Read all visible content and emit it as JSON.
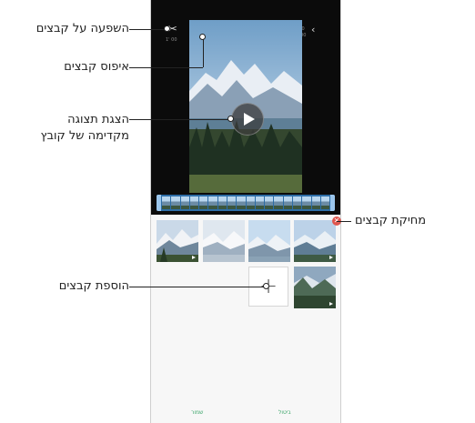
{
  "callouts": {
    "apply_effect": "השפעה על קבצים",
    "reset_files": "איפוס קבצים",
    "preview_line1": "הצגת תצוגה",
    "preview_line2": "מקדימה של קובץ",
    "delete_files": "מחיקת קבצים",
    "add_files": "הוספת קבצים"
  },
  "editor": {
    "icons": [
      "effects-icon",
      "reset-icon",
      "play-icon",
      "back-arrow-icon"
    ],
    "top_left_small": "1' 00",
    "top_right_small": "7600",
    "top_right_small2": "00:00"
  },
  "buttons": {
    "add_symbol": "+",
    "delete_symbol": "✕",
    "bottom_left": "שמור",
    "bottom_right": "ביטול"
  },
  "colors": {
    "editor_bg": "#0b0b0b",
    "timeline": "#2d6da6",
    "delete": "#e0564e",
    "bottom_text": "#3da66b"
  }
}
